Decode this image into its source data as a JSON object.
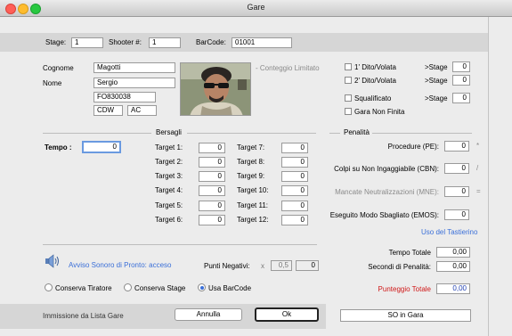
{
  "window": {
    "title": "Gare"
  },
  "header": {
    "stage_label": "Stage:",
    "stage_value": "1",
    "shooter_label": "Shooter #:",
    "shooter_value": "1",
    "barcode_label": "BarCode:",
    "barcode_value": "01001"
  },
  "shooter": {
    "cognome_label": "Cognome",
    "cognome_value": "Magotti",
    "nome_label": "Nome",
    "nome_value": "Sergio",
    "code_value": "FO830038",
    "division_value": "CDW",
    "category_value": "AC",
    "conteggio_label": "- Conteggio Limitato"
  },
  "flags": {
    "dito1_label": "1' Dito/Volata",
    "stage1_label": ">Stage",
    "stage1_value": "0",
    "dito2_label": "2' Dito/Volata",
    "stage2_label": ">Stage",
    "stage2_value": "0",
    "squalificato_label": "Squalificato",
    "stage3_label": ">Stage",
    "stage3_value": "0",
    "non_finita_label": "Gara Non Finita"
  },
  "bersagli": {
    "section_label": "Bersagli",
    "tempo_label": "Tempo :",
    "tempo_value": "0",
    "targets_left": [
      {
        "label": "Target  1:",
        "value": "0"
      },
      {
        "label": "Target  2:",
        "value": "0"
      },
      {
        "label": "Target  3:",
        "value": "0"
      },
      {
        "label": "Target  4:",
        "value": "0"
      },
      {
        "label": "Target  5:",
        "value": "0"
      },
      {
        "label": "Target  6:",
        "value": "0"
      }
    ],
    "targets_right": [
      {
        "label": "Target  7:",
        "value": "0"
      },
      {
        "label": "Target  8:",
        "value": "0"
      },
      {
        "label": "Target  9:",
        "value": "0"
      },
      {
        "label": "Target 10:",
        "value": "0"
      },
      {
        "label": "Target 11:",
        "value": "0"
      },
      {
        "label": "Target 12:",
        "value": "0"
      }
    ]
  },
  "penalita": {
    "section_label": "Penalità",
    "procedure_label": "Procedure (PE):",
    "procedure_value": "0",
    "procedure_op": "*",
    "colpi_label": "Colpi su Non Ingaggiabile (CBN):",
    "colpi_value": "0",
    "colpi_op": "/",
    "mancate_label": "Mancate Neutralizzazioni (MNE):",
    "mancate_value": "0",
    "mancate_op": "=",
    "eseguito_label": "Eseguito Modo Sbagliato (EMOS):",
    "eseguito_value": "0",
    "tastierino_link": "Uso del Tastierino"
  },
  "totals": {
    "tempo_totale_label": "Tempo Totale",
    "tempo_totale_value": "0,00",
    "secondi_label": "Secondi di Penalità:",
    "secondi_value": "0,00",
    "punteggio_label": "Punteggio Totale",
    "punteggio_value": "0,00"
  },
  "audio": {
    "avviso_label": "Avviso Sonoro di Pronto: acceso"
  },
  "punti": {
    "label": "Punti Negativi:",
    "x": "x",
    "factor": "0,5",
    "value": "0"
  },
  "options": {
    "conserva_tiratore": "Conserva Tiratore",
    "conserva_stage": "Conserva Stage",
    "usa_barcode": "Usa BarCode"
  },
  "footer": {
    "status_label": "Immissione da Lista Gare",
    "annulla": "Annulla",
    "ok": "Ok",
    "so_in_gara": "SO in Gara"
  },
  "colors": {
    "link": "#3a6fd8",
    "accent_red": "#d01818",
    "grey_text": "#8a8a8a"
  }
}
